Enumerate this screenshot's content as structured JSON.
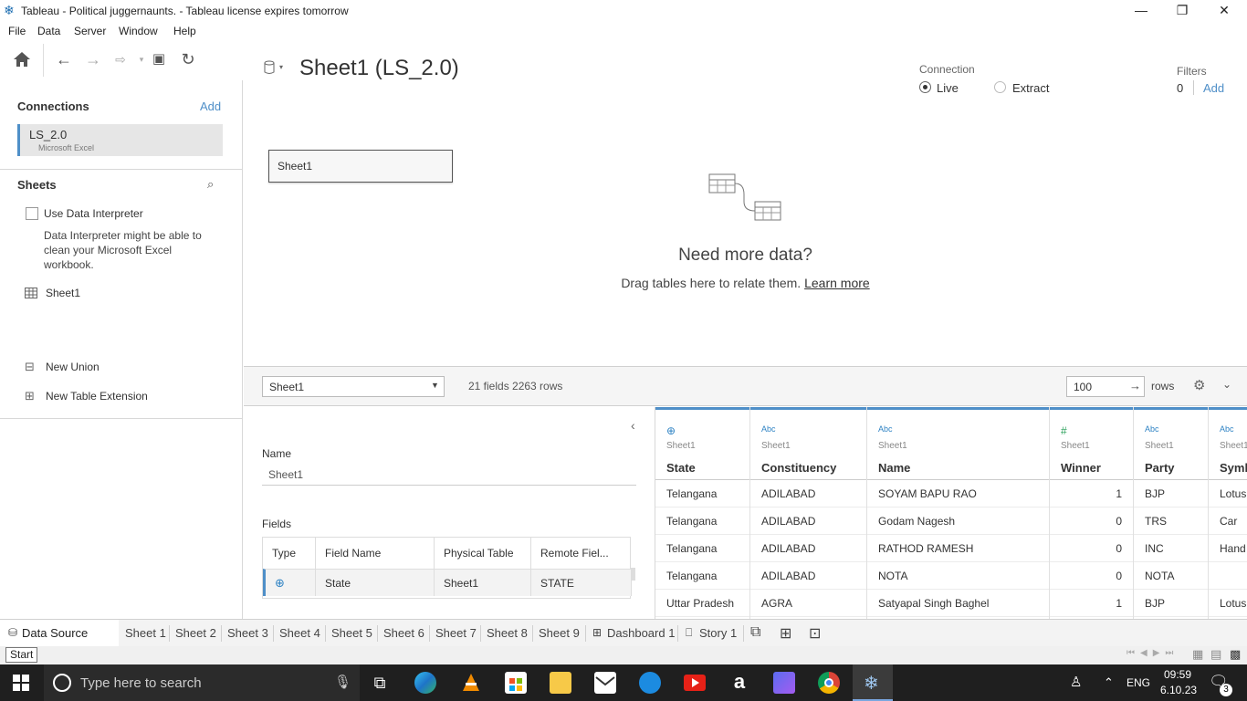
{
  "window": {
    "title": "Tableau - Political juggernaunts. - Tableau license expires tomorrow",
    "minimize": "—",
    "restore": "❐",
    "close": "✕"
  },
  "menu": [
    "File",
    "Data",
    "Server",
    "Window",
    "Help"
  ],
  "connections": {
    "title": "Connections",
    "add_label": "Add",
    "item_name": "LS_2.0",
    "item_type": "Microsoft Excel"
  },
  "sheets": {
    "title": "Sheets",
    "use_interpreter_label": "Use Data Interpreter",
    "interpreter_hint": "Data Interpreter might be able to clean your Microsoft Excel workbook.",
    "sheet_item": "Sheet1",
    "new_union": "New Union",
    "new_table_extension": "New Table Extension"
  },
  "canvas": {
    "datasource_title": "Sheet1 (LS_2.0)",
    "connection_label": "Connection",
    "live_label": "Live",
    "extract_label": "Extract",
    "filters_label": "Filters",
    "filters_count": "0",
    "filters_add": "Add",
    "table_box": "Sheet1",
    "need_more_data": "Need more data?",
    "drag_hint": "Drag tables here to relate them.",
    "learn_more": "Learn more"
  },
  "grid_toolbar": {
    "table_select": "Sheet1",
    "summary": "21 fields 2263 rows",
    "rows_value": "100",
    "rows_label": "rows"
  },
  "metadata": {
    "name_label": "Name",
    "name_value": "Sheet1",
    "fields_label": "Fields",
    "headers": [
      "Type",
      "Field Name",
      "Physical Table",
      "Remote Fiel..."
    ],
    "row": {
      "field_name": "State",
      "physical_table": "Sheet1",
      "remote_field": "STATE"
    }
  },
  "grid": {
    "columns": [
      {
        "type": "geo",
        "icon": "⊕",
        "source": "Sheet1",
        "name": "State"
      },
      {
        "type": "abc",
        "icon": "Abc",
        "source": "Sheet1",
        "name": "Constituency"
      },
      {
        "type": "abc",
        "icon": "Abc",
        "source": "Sheet1",
        "name": "Name"
      },
      {
        "type": "num",
        "icon": "#",
        "source": "Sheet1",
        "name": "Winner"
      },
      {
        "type": "abc",
        "icon": "Abc",
        "source": "Sheet1",
        "name": "Party"
      },
      {
        "type": "abc",
        "icon": "Abc",
        "source": "Sheet1",
        "name": "Symbol"
      }
    ],
    "rows": [
      [
        "Telangana",
        "ADILABAD",
        "SOYAM BAPU RAO",
        "1",
        "BJP",
        "Lotus"
      ],
      [
        "Telangana",
        "ADILABAD",
        "Godam Nagesh",
        "0",
        "TRS",
        "Car"
      ],
      [
        "Telangana",
        "ADILABAD",
        "RATHOD RAMESH",
        "0",
        "INC",
        "Hand"
      ],
      [
        "Telangana",
        "ADILABAD",
        "NOTA",
        "0",
        "NOTA",
        ""
      ],
      [
        "Uttar Pradesh",
        "AGRA",
        "Satyapal Singh Baghel",
        "1",
        "BJP",
        "Lotus"
      ]
    ]
  },
  "tabs": {
    "data_source": "Data Source",
    "sheets": [
      "Sheet 1",
      "Sheet 2",
      "Sheet 3",
      "Sheet 4",
      "Sheet 5",
      "Sheet 6",
      "Sheet 7",
      "Sheet 8",
      "Sheet 9"
    ],
    "dashboard": "Dashboard 1",
    "story": "Story 1"
  },
  "status": {
    "start_tooltip": "Start"
  },
  "taskbar": {
    "search_placeholder": "Type here to search",
    "lang": "ENG",
    "time": "09:59",
    "date": "6.10.23",
    "notif_count": "3"
  },
  "colors": {
    "accent": "#4f8fc8",
    "taskbar": "#1f1f1f"
  }
}
